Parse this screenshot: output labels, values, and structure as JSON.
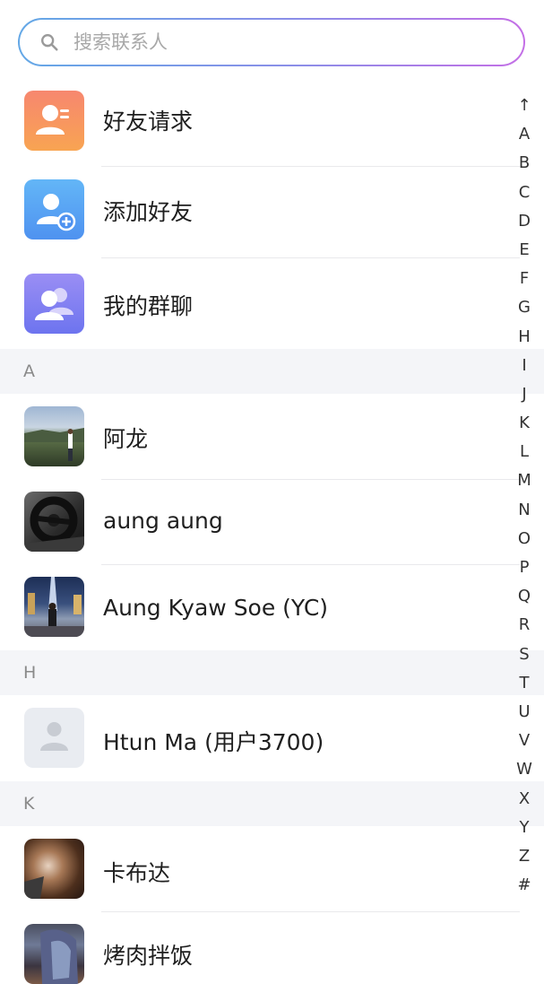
{
  "search": {
    "placeholder": "搜索联系人"
  },
  "features": [
    {
      "label": "好友请求",
      "icon": "friend-request-icon"
    },
    {
      "label": "添加好友",
      "icon": "add-friend-icon"
    },
    {
      "label": "我的群聊",
      "icon": "group-chat-icon"
    }
  ],
  "sections": [
    {
      "letter": "A",
      "contacts": [
        {
          "name": "阿龙"
        },
        {
          "name": "aung aung"
        },
        {
          "name": "Aung Kyaw Soe (YC)"
        }
      ]
    },
    {
      "letter": "H",
      "contacts": [
        {
          "name": "Htun Ma (用户3700)"
        }
      ]
    },
    {
      "letter": "K",
      "contacts": [
        {
          "name": "卡布达"
        },
        {
          "name": "烤肉拌饭"
        }
      ]
    }
  ],
  "index_letters": [
    "↑",
    "A",
    "B",
    "C",
    "D",
    "E",
    "F",
    "G",
    "H",
    "I",
    "J",
    "K",
    "L",
    "M",
    "N",
    "O",
    "P",
    "Q",
    "R",
    "S",
    "T",
    "U",
    "V",
    "W",
    "X",
    "Y",
    "Z",
    "#"
  ],
  "colors": {
    "search_gradient": [
      "#64a8e6",
      "#c46fe6"
    ],
    "section_bg": "#f4f5f8",
    "friend_request": "#f79068",
    "add_friend": "#5aa8f5",
    "group_chat": "#7f7ff0"
  }
}
